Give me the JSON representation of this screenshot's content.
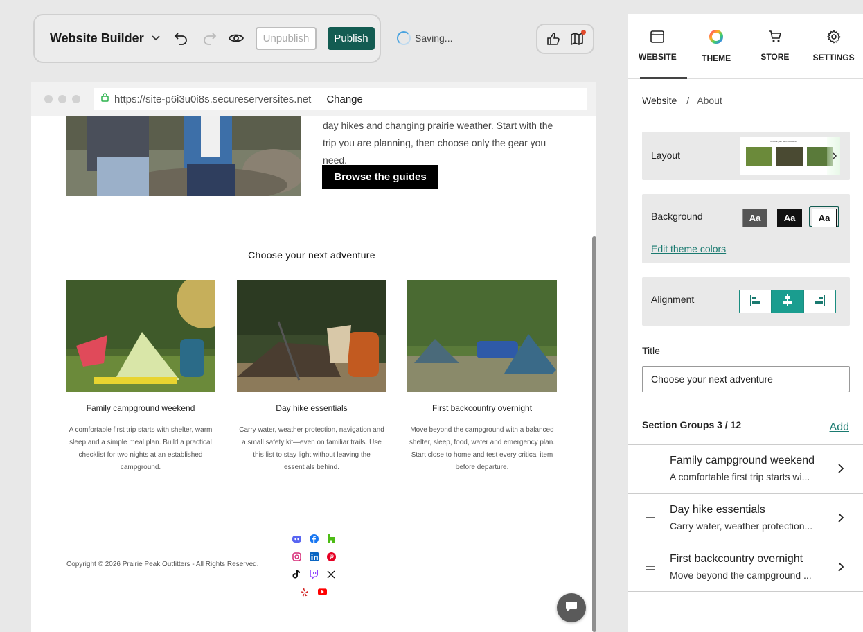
{
  "toolbar": {
    "title": "Website Builder",
    "unpublish_label": "Unpublish",
    "publish_label": "Publish",
    "status_text": "Saving..."
  },
  "browser": {
    "url": "https://site-p6i3u0i8s.secureserversites.net",
    "change_label": "Change"
  },
  "site": {
    "hero_text": "day hikes and changing prairie weather. Start with the trip you are planning, then choose only the gear you need.",
    "cta_label": "Browse the guides",
    "section_title": "Choose your next adventure",
    "cards": [
      {
        "title": "Family campground weekend",
        "desc": "A comfortable first trip starts with shelter, warm sleep and a simple meal plan. Build a practical checklist for two nights at an established campground."
      },
      {
        "title": "Day hike essentials",
        "desc": "Carry water, weather protection, navigation and a small safety kit—even on familiar trails. Use this list to stay light without leaving the essentials behind."
      },
      {
        "title": "First backcountry overnight",
        "desc": "Move beyond the campground with a balanced shelter, sleep, food, water and emergency plan. Start close to home and test every critical item before departure."
      }
    ],
    "copyright": "Copyright © 2026 Prairie Peak Outfitters - All Rights Reserved.",
    "social_icons": [
      "discord-icon",
      "facebook-icon",
      "houzz-icon",
      "instagram-icon",
      "linkedin-icon",
      "pinterest-icon",
      "tiktok-icon",
      "twitch-icon",
      "x-icon",
      "yelp-icon",
      "youtube-icon"
    ]
  },
  "panel": {
    "tabs": [
      {
        "label": "WEBSITE",
        "icon": "browser-window-icon"
      },
      {
        "label": "THEME",
        "icon": "color-wheel-icon"
      },
      {
        "label": "STORE",
        "icon": "cart-icon"
      },
      {
        "label": "SETTINGS",
        "icon": "gear-icon"
      }
    ],
    "breadcrumb_root": "Website",
    "breadcrumb_sep": "/",
    "breadcrumb_current": "About",
    "layout_label": "Layout",
    "layout_thumb_title": "Choose your next adventure",
    "background_label": "Background",
    "swatch_label": "Aa",
    "edit_colors_label": "Edit theme colors",
    "alignment_label": "Alignment",
    "title_label": "Title",
    "title_value": "Choose your next adventure",
    "section_groups_label": "Section Groups 3 / 12",
    "add_label": "Add",
    "groups": [
      {
        "title": "Family campground weekend",
        "desc": "A comfortable first trip starts wi..."
      },
      {
        "title": "Day hike essentials",
        "desc": "Carry water, weather protection..."
      },
      {
        "title": "First backcountry overnight",
        "desc": "Move beyond the campground ..."
      }
    ]
  },
  "colors": {
    "accent": "#135c52",
    "teal": "#1a8d80",
    "bg": "#e8e8e8"
  }
}
